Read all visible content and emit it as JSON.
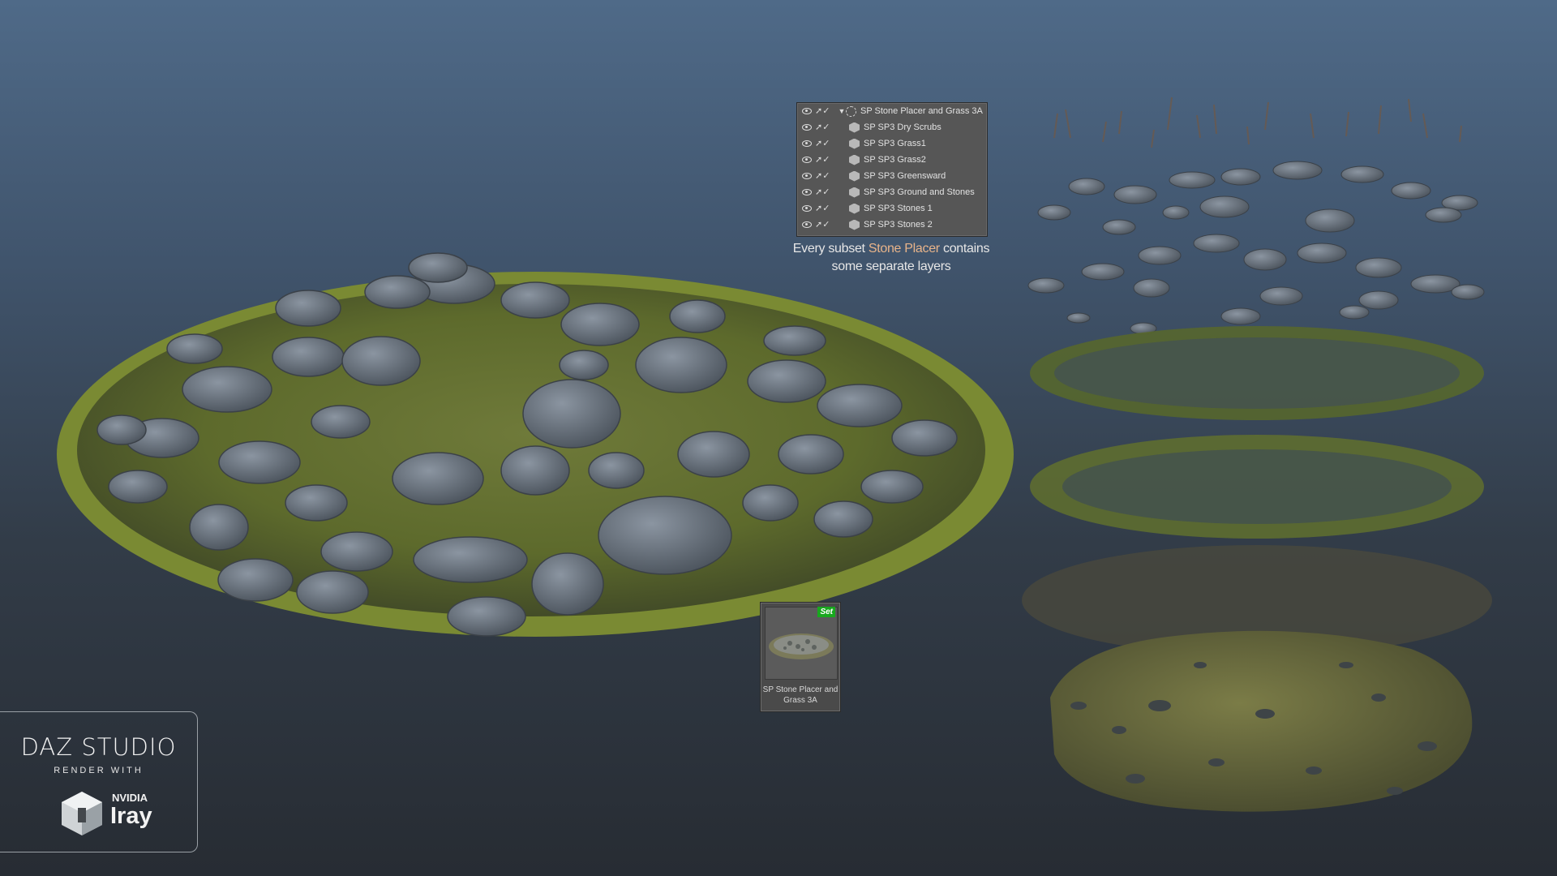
{
  "scene_tree": {
    "root": "SP Stone Placer and Grass 3A",
    "items": [
      "SP SP3 Dry Scrubs",
      "SP SP3 Grass1",
      "SP SP3 Grass2",
      "SP SP3 Greensward",
      "SP SP3 Ground and Stones",
      "SP SP3 Stones 1",
      "SP SP3 Stones 2"
    ]
  },
  "caption": {
    "line1_pre": "Every subset ",
    "line1_highlight": "Stone Placer",
    "line1_post": " contains",
    "line2": "some separate layers"
  },
  "product_card": {
    "badge": "Set",
    "name": "SP Stone Placer and Grass 3A"
  },
  "logo": {
    "brand": "DAZ STUDIO",
    "subtitle": "RENDER WITH",
    "vendor": "NVIDIA",
    "product": "Iray"
  },
  "colors": {
    "highlight": "#e8b48a",
    "badge": "#18a81e",
    "panel": "#565656"
  },
  "icons": [
    "eye-icon",
    "pointer-icon",
    "group-icon",
    "cube-icon",
    "iray-cube-icon"
  ]
}
